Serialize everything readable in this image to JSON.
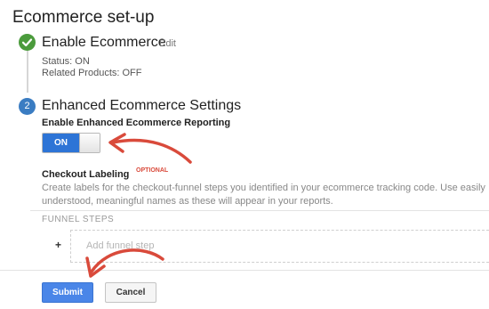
{
  "page_title": "Ecommerce set-up",
  "step1": {
    "title": "Enable Ecommerce",
    "edit_label": "Edit",
    "status_line": "Status: ON",
    "related_line": "Related Products: OFF"
  },
  "step2": {
    "number": "2",
    "title": "Enhanced Ecommerce Settings",
    "reporting_label": "Enable Enhanced Ecommerce Reporting",
    "toggle_label": "ON",
    "checkout_label": "Checkout Labeling",
    "optional_tag": "OPTIONAL",
    "description": "Create labels for the checkout-funnel steps you identified in your ecommerce tracking code. Use easily understood, meaningful names as these will appear in your reports.",
    "funnel_heading": "FUNNEL STEPS",
    "add_symbol": "+",
    "add_placeholder": "Add funnel step"
  },
  "actions": {
    "submit_label": "Submit",
    "cancel_label": "Cancel"
  },
  "colors": {
    "accent_blue": "#4a86e8",
    "toggle_blue": "#2d74d6",
    "success_green": "#4b9b3c",
    "annotation_red": "#d94a3b"
  },
  "icons": {
    "step1": "check-icon",
    "annotations": "red-arrow-icon"
  }
}
